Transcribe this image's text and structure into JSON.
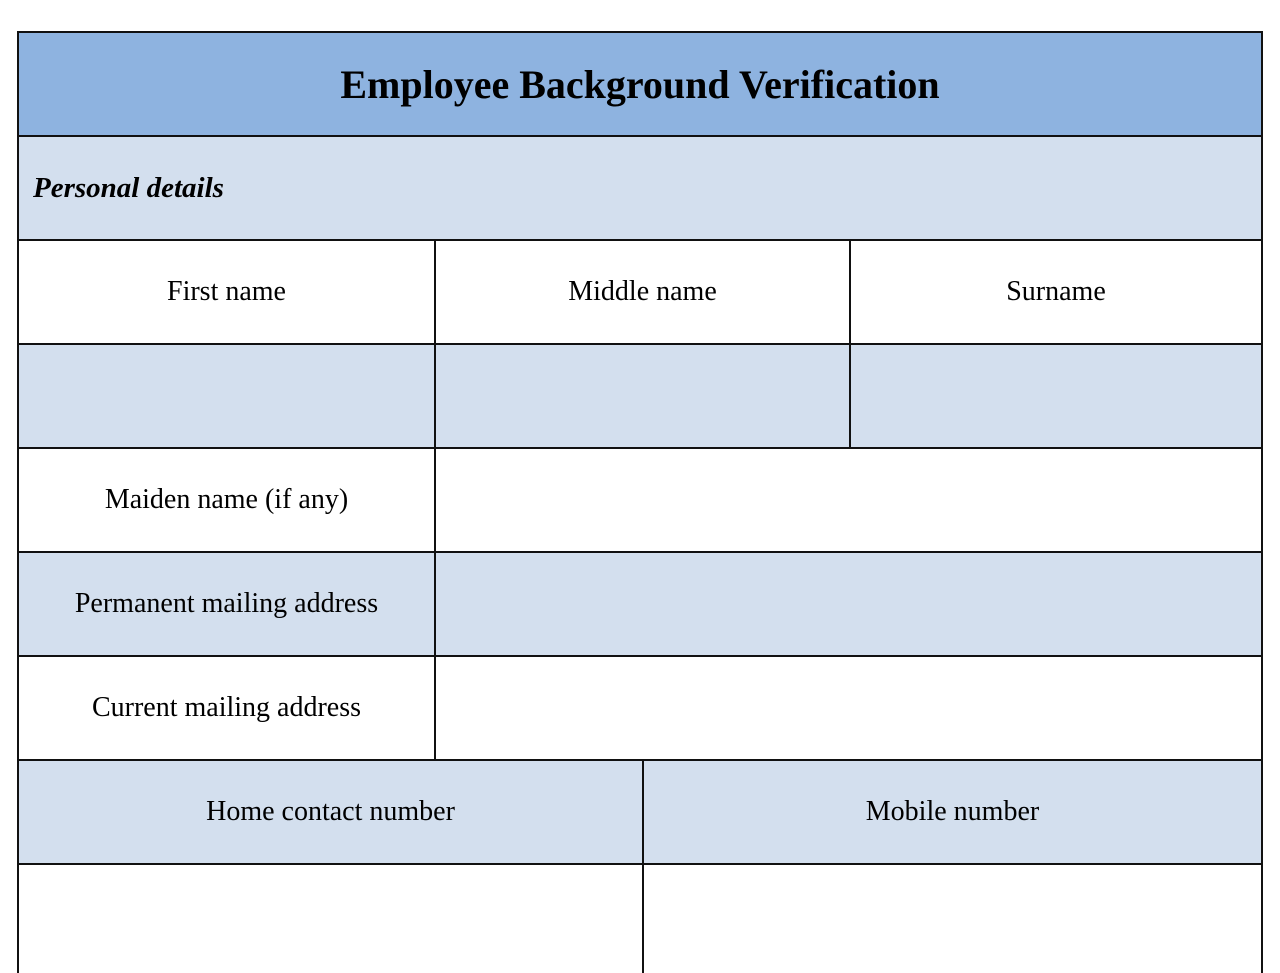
{
  "form": {
    "title": "Employee Background Verification",
    "section": "Personal details",
    "name_headers": [
      "First name",
      "Middle name",
      "Surname"
    ],
    "name_values": [
      "",
      "",
      ""
    ],
    "fields": [
      {
        "label": "Maiden name (if any)",
        "value": ""
      },
      {
        "label": "Permanent mailing address",
        "value": ""
      },
      {
        "label": "Current mailing address",
        "value": ""
      }
    ],
    "contact_headers": [
      "Home contact number",
      "Mobile number"
    ],
    "contact_values": [
      "",
      ""
    ]
  },
  "colors": {
    "title_bg": "#8eb3e0",
    "alt_row_bg": "#d3dfee",
    "border": "#111111"
  }
}
